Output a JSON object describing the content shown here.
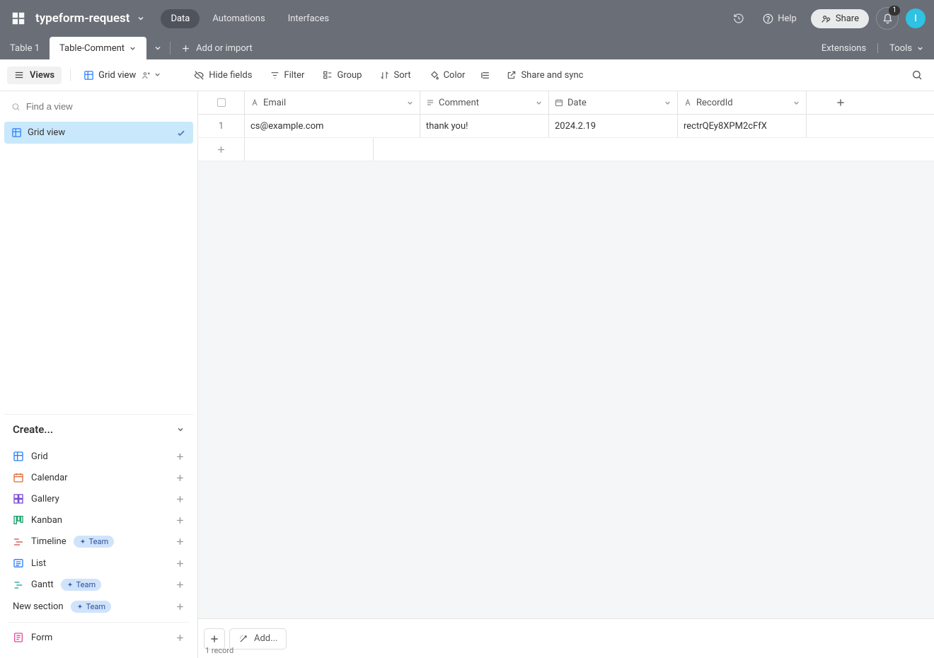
{
  "brand_accent": "#2fc2e3",
  "header": {
    "base_title": "typeform-request",
    "nav": {
      "data": "Data",
      "automations": "Automations",
      "interfaces": "Interfaces"
    },
    "help": "Help",
    "share": "Share",
    "notification_count": "1",
    "avatar_initial": "I"
  },
  "tabs": {
    "table1": "Table 1",
    "table_comment": "Table-Comment",
    "add_import": "Add or import",
    "extensions": "Extensions",
    "tools": "Tools"
  },
  "toolbar": {
    "views": "Views",
    "grid_view": "Grid view",
    "hide_fields": "Hide fields",
    "filter": "Filter",
    "group": "Group",
    "sort": "Sort",
    "color": "Color",
    "share_sync": "Share and sync"
  },
  "sidebar": {
    "find_placeholder": "Find a view",
    "active_view": "Grid view",
    "create_header": "Create...",
    "team_label": "Team",
    "create_items": {
      "grid": "Grid",
      "calendar": "Calendar",
      "gallery": "Gallery",
      "kanban": "Kanban",
      "timeline": "Timeline",
      "list": "List",
      "gantt": "Gantt",
      "new_section": "New section",
      "form": "Form"
    }
  },
  "columns": {
    "email": "Email",
    "comment": "Comment",
    "date": "Date",
    "recordid": "RecordId"
  },
  "rows": [
    {
      "index": "1",
      "email": "cs@example.com",
      "comment": "thank you!",
      "date": "2024.2.19",
      "recordid": "rectrQEy8XPM2cFfX"
    }
  ],
  "footer": {
    "add_label": "Add...",
    "record_count": "1 record"
  }
}
